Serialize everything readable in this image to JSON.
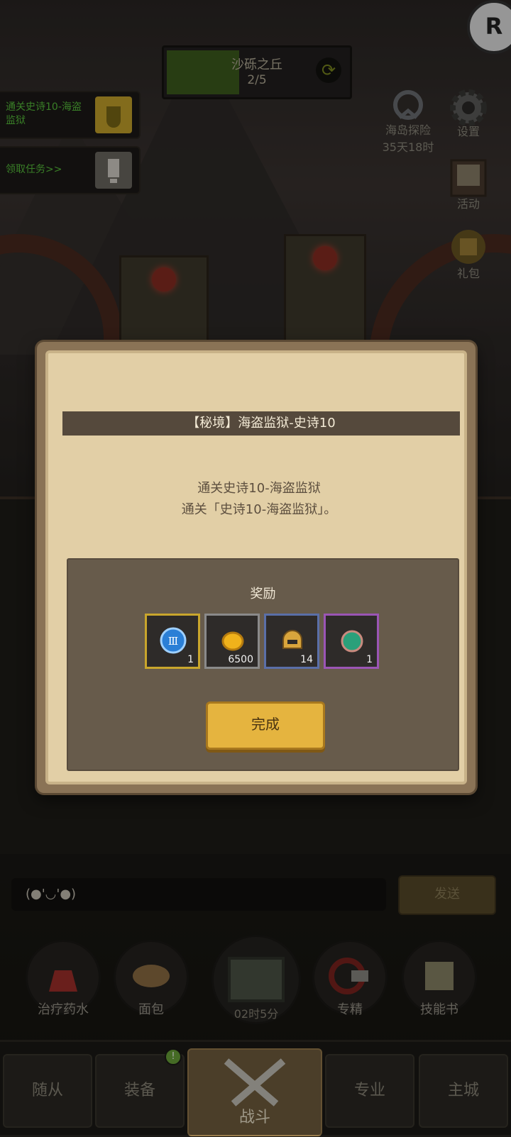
{
  "top": {
    "stage_name": "沙砾之丘",
    "stage_progress": "2/5",
    "stage_progress_fraction": 0.4
  },
  "quests": [
    {
      "text": "通关史诗10-海盗监狱",
      "icon": "tombstone-icon",
      "box_color": "#c9a62c"
    },
    {
      "text": "领取任务>>",
      "icon": "flag-icon",
      "box_color": "#6e6a63"
    }
  ],
  "side_buttons": {
    "corner": "R",
    "island": {
      "label": "海岛探险",
      "sub": "35天18时"
    },
    "settings": {
      "label": "设置"
    },
    "events": {
      "label": "活动"
    },
    "gift": {
      "label": "礼包"
    }
  },
  "modal": {
    "title": "【秘境】海盗监狱-史诗10",
    "desc_line1": "通关史诗10-海盗监狱",
    "desc_line2": "通关「史诗10-海盗监狱」。",
    "reward_title": "奖励",
    "rewards": [
      {
        "icon": "roman-three-medal-icon",
        "qty": "1",
        "border": "#c9a62c"
      },
      {
        "icon": "gold-coin-icon",
        "qty": "6500",
        "border": "#8a8a8a"
      },
      {
        "icon": "helmet-icon",
        "qty": "14",
        "border": "#5a6fa8"
      },
      {
        "icon": "gem-icon",
        "qty": "1",
        "border": "#9b55b5"
      }
    ],
    "done_label": "完成"
  },
  "chat": {
    "input_value": "(●'◡'●)",
    "send_label": "发送"
  },
  "skills": [
    {
      "label": "治疗药水",
      "icon": "potion-icon"
    },
    {
      "label": "面包",
      "icon": "bread-icon"
    },
    {
      "label": "专精",
      "icon": "target-icon"
    },
    {
      "label": "技能书",
      "icon": "book-icon"
    }
  ],
  "chest": {
    "timer": "02时5分",
    "icon": "chest-icon"
  },
  "tabs": [
    {
      "label": "随从"
    },
    {
      "label": "装备",
      "badge": "!"
    },
    {
      "label": "战斗",
      "icon": "crossed-swords-icon"
    },
    {
      "label": "专业"
    },
    {
      "label": "主城"
    }
  ]
}
